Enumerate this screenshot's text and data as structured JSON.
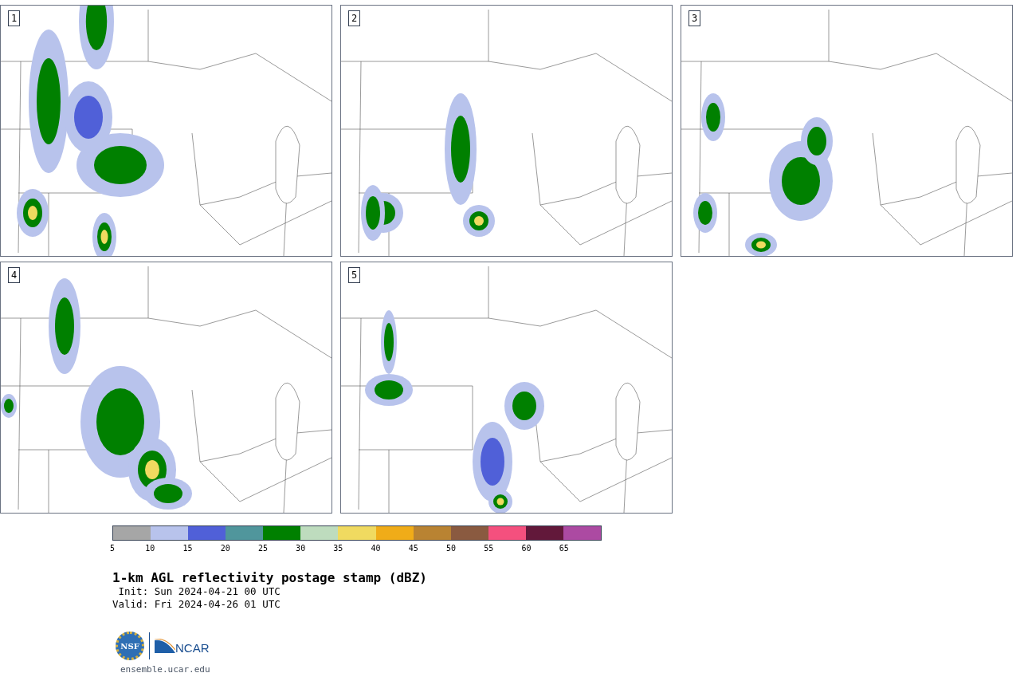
{
  "panels": [
    {
      "label": "1"
    },
    {
      "label": "2"
    },
    {
      "label": "3"
    },
    {
      "label": "4"
    },
    {
      "label": "5"
    }
  ],
  "colorbar": {
    "bins": [
      {
        "color": "#a6a6a6"
      },
      {
        "color": "#b8c3ec"
      },
      {
        "color": "#5060d8"
      },
      {
        "color": "#50969c"
      },
      {
        "color": "#008000"
      },
      {
        "color": "#bedcbe"
      },
      {
        "color": "#f0da60"
      },
      {
        "color": "#f0ac18"
      },
      {
        "color": "#b98332"
      },
      {
        "color": "#8a5a40"
      },
      {
        "color": "#f4507e"
      },
      {
        "color": "#62183a"
      },
      {
        "color": "#ac4aa2"
      }
    ],
    "ticks": [
      "5",
      "10",
      "15",
      "20",
      "25",
      "30",
      "35",
      "40",
      "45",
      "50",
      "55",
      "60",
      "65"
    ]
  },
  "title": "1-km AGL reflectivity postage stamp (dBZ)",
  "init": " Init: Sun 2024-04-21 00 UTC",
  "valid": "Valid: Fri 2024-04-26 01 UTC",
  "logos": {
    "seal": "NSF",
    "wordmark": "NCAR"
  },
  "url": "ensemble.ucar.edu"
}
